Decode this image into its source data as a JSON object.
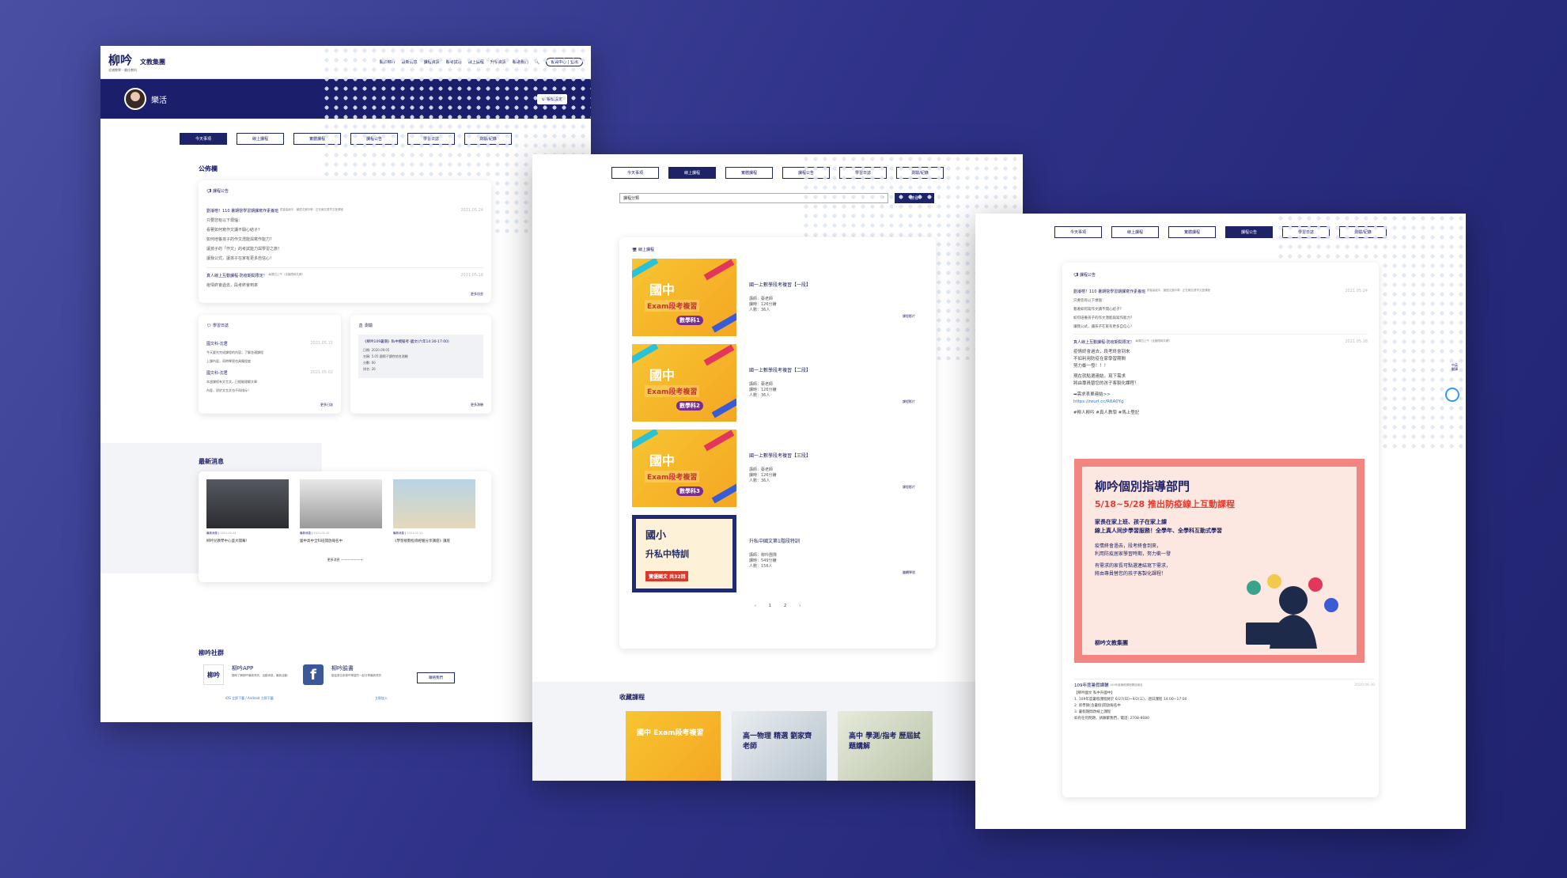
{
  "brand": {
    "name": "柳吟",
    "sub": "文教集團",
    "tagline": "北埔教學・最佳教科"
  },
  "nav": {
    "items": [
      "關於柳吟",
      "最新消息",
      "課程資訊",
      "聯考試題",
      "線上課程",
      "升學資訊",
      "聯絡我們"
    ],
    "auth": "登入/註冊",
    "member": "會員中心",
    "logout": "登出"
  },
  "user": {
    "name": "樂活",
    "settings": "帳號設定"
  },
  "tabs": [
    "今天事項",
    "線上課程",
    "實體課程",
    "課程公告",
    "學習日誌",
    "測驗/紀錄"
  ],
  "bulletin": {
    "section": "公佈欄",
    "header": "課程公告",
    "posts": [
      {
        "title": "劉濬榕！110 暑期營學習期課寫作素養班",
        "meta": "書香高級中 . 國語文國中學 . 正在報名提早文藝課程",
        "date": "2021.05.24",
        "lines": [
          "只要您有以下煩惱：",
          "看著如何寫作文讀不開心結子？",
          "如何培養孩子的作文潛能與寫作能力？",
          "讓孩子的「作文」的考試能力與學習之旅！",
          "讓我公式，讓孩子在家有更多自信心！"
        ]
      },
      {
        "title": "真人線上互動課程-防疫期間限定！",
        "meta": "每周四上午（全國限時共網）",
        "date": "2021.05.18",
        "lines": [
          "疫情終會過去，段考終會到來"
        ]
      }
    ],
    "more": "更多訊息"
  },
  "diary": {
    "header": "學習日誌",
    "items": [
      {
        "name": "國文科-沈君",
        "date": "2021.05.15",
        "text": "今天要先完成課程的內容；了解並通課程",
        "sub": "上課內容，同時學習也具備程度"
      },
      {
        "name": "國文科-沈君",
        "date": "2021.05.02",
        "text": "本週課程有文言文，已經能理解文章",
        "sub": "內容，對於文言文也不再排斥！"
      }
    ],
    "more": "更多日誌"
  },
  "exam": {
    "header": "測驗",
    "title": "《柳吟109暑期》私中模擬考-國文(六年14:30-17:00)",
    "lines": [
      "日期: 2020.09.05",
      "名稱: 5.05 國際子讀性綜合測驗",
      "分數: 60",
      "排名: 26"
    ],
    "more": "更多測驗"
  },
  "news": {
    "section": "最新消息",
    "items": [
      {
        "cat": "最新消息",
        "date": "2021.02.04",
        "title": "柳吟兒教學中心盛大開幕！"
      },
      {
        "cat": "最新消息",
        "date": "2021.02.10",
        "title": "國中高中全科班開放報名中"
      },
      {
        "cat": "最新消息",
        "date": "2021.02.11",
        "title": "《學習規劃指導經驗分享講座》講座"
      }
    ],
    "more": "更多消息"
  },
  "social": {
    "section": "柳吟社群",
    "app": {
      "title": "柳吟APP",
      "desc": "隨時了解柳吟最新資訊，活動消息，最新活動！",
      "links": "iOS 立即下載 / Android 立即下載"
    },
    "fb": {
      "title": "柳吟臉書",
      "desc": "歡迎各位來柳吟學習的一起分享最新資訊",
      "link": "立即加入"
    },
    "contact": "聯絡我們"
  },
  "online": {
    "select": "課程分類",
    "search": "搜尋",
    "header": "線上課程",
    "courses": [
      {
        "title": "國一上數學段考複習【一段】",
        "t1": "國中",
        "t2": "Exam段考複習",
        "t3": "數學科1",
        "teacher": "講師：蔡老師",
        "hours": "課時：126分鐘",
        "students": "人數：36人",
        "action": "課程影片"
      },
      {
        "title": "國一上數學段考複習【二段】",
        "t1": "國中",
        "t2": "Exam段考複習",
        "t3": "數學科2",
        "teacher": "講師：蔡老師",
        "hours": "課時：126分鐘",
        "students": "人數：36人",
        "action": "課程影片"
      },
      {
        "title": "國一上數學段考複習【三段】",
        "t1": "國中",
        "t2": "Exam段考複習",
        "t3": "數學科3",
        "teacher": "講師：蔡老師",
        "hours": "課時：126分鐘",
        "students": "人數：36人",
        "action": "課程影片"
      },
      {
        "title": "升私中國文第1階段特訓",
        "t1": "國小",
        "t2": "升私中特訓",
        "t3": "寶優國文 共32回",
        "teacher": "講師：柳吟團隊",
        "hours": "課時：549分鐘",
        "students": "人數：156人",
        "action": "繼續學習"
      }
    ],
    "pager": [
      "‹",
      "1",
      "2",
      "›"
    ],
    "fav": "收藏課程",
    "favs": [
      "國中 Exam段考複習",
      "高一物理 精選 劉家齊老師",
      "高中 學測/指考 歷屆試題講解"
    ]
  },
  "announce": {
    "header": "課程公告",
    "posts": [
      {
        "title": "劉濬榕！110 暑期營學習期課寫作素養班",
        "meta": "書香高級中 . 國語文國中學 . 正在報名提早文藝課程",
        "date": "2021.05.24",
        "lines": [
          "只要您有以下煩惱：",
          "看著如何寫作文讀不開心結子？",
          "如何培養孩子的作文潛能與寫作能力？",
          "讓我公式，讓孩子在家有更多自信心！"
        ]
      },
      {
        "title": "真人線上互動課程-防疫期間限定！",
        "meta": "每周四上午（全國限時共網）",
        "date": "2021.05.18",
        "lines": [
          "疫情終會過去，段考終會到來",
          "不如利用防疫在家學習期間",
          "努力衝一發！！！",
          "",
          "現在就點選連結，寫下需求",
          "將由專員替您的孩子客製化課程！",
          "",
          "➡需求表單連結>>",
          "https://reurl.cc/R6A0Yg",
          "",
          "#柳人柳吟 #真人教學 #馬上登記"
        ]
      }
    ],
    "poster": {
      "title": "柳吟個別指導部門",
      "sub": "5/18~5/28 推出防疫線上互動課程",
      "l1": "家長在家上班、孩子在家上課",
      "l2": "線上真人同步學習服務！全學年、全學科互動式學習",
      "l3": "疫情終會過去，段考終會到來，",
      "l4": "利用防疫居家學習時期，努力衝一發",
      "l5": "有需求的家長可點選連結寫下需求，",
      "l6": "將由專員替您的孩子客製化課程！",
      "brand": "柳吟文教集團"
    },
    "post3": {
      "title": "109年度暑假課輔",
      "meta": "109年度暑假課程開放報名",
      "date": "2020.06.30",
      "lines": [
        "【柳吟國文 私中升國中】",
        "1. 109年度暑假課程將於 6/27(日)~9/2(三)，週日課程 14:00~17:00",
        "2. 新學期(含暑假)開放報名中",
        "3. 暑假期間改線上課程"
      ],
      "contact": "如有任何問題，請聯繫我們，電話: 2708-8680"
    },
    "side": "中英 翻譯"
  }
}
